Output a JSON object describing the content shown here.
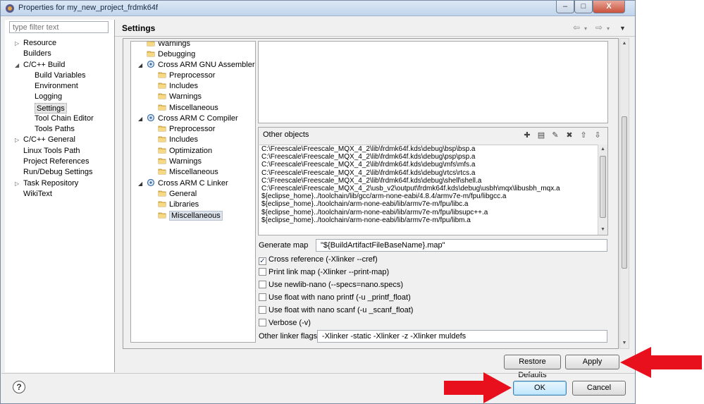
{
  "window": {
    "title": "Properties for my_new_project_frdmk64f",
    "minimize": "–",
    "maximize": "□",
    "close": "X"
  },
  "filter": {
    "placeholder": "type filter text"
  },
  "nav": [
    {
      "label": "Resource",
      "expander": "▷"
    },
    {
      "label": "Builders",
      "expander": ""
    },
    {
      "label": "C/C++ Build",
      "expander": "◢"
    },
    {
      "label": "Build Variables",
      "expander": ""
    },
    {
      "label": "Environment",
      "expander": ""
    },
    {
      "label": "Logging",
      "expander": ""
    },
    {
      "label": "Settings",
      "expander": "",
      "selected": true
    },
    {
      "label": "Tool Chain Editor",
      "expander": ""
    },
    {
      "label": "Tools Paths",
      "expander": ""
    },
    {
      "label": "C/C++ General",
      "expander": "▷"
    },
    {
      "label": "Linux Tools Path",
      "expander": ""
    },
    {
      "label": "Project References",
      "expander": ""
    },
    {
      "label": "Run/Debug Settings",
      "expander": ""
    },
    {
      "label": "Task Repository",
      "expander": "▷"
    },
    {
      "label": "WikiText",
      "expander": ""
    }
  ],
  "header": {
    "title": "Settings",
    "back": "⇦",
    "forward": "⇨",
    "dropdown": "▾",
    "menu": "▼"
  },
  "tree": [
    {
      "label": "Warnings",
      "icon": "folder-icon",
      "expander": ""
    },
    {
      "label": "Debugging",
      "icon": "folder-icon",
      "expander": ""
    },
    {
      "label": "Cross ARM GNU Assembler",
      "icon": "gear-icon",
      "expander": "◢"
    },
    {
      "label": "Preprocessor",
      "icon": "folder-icon",
      "expander": ""
    },
    {
      "label": "Includes",
      "icon": "folder-icon",
      "expander": ""
    },
    {
      "label": "Warnings",
      "icon": "folder-icon",
      "expander": ""
    },
    {
      "label": "Miscellaneous",
      "icon": "folder-icon",
      "expander": ""
    },
    {
      "label": "Cross ARM C Compiler",
      "icon": "gear-icon",
      "expander": "◢"
    },
    {
      "label": "Preprocessor",
      "icon": "folder-icon",
      "expander": ""
    },
    {
      "label": "Includes",
      "icon": "folder-icon",
      "expander": ""
    },
    {
      "label": "Optimization",
      "icon": "folder-icon",
      "expander": ""
    },
    {
      "label": "Warnings",
      "icon": "folder-icon",
      "expander": ""
    },
    {
      "label": "Miscellaneous",
      "icon": "folder-icon",
      "expander": ""
    },
    {
      "label": "Cross ARM C Linker",
      "icon": "gear-icon",
      "expander": "◢"
    },
    {
      "label": "General",
      "icon": "folder-icon",
      "expander": ""
    },
    {
      "label": "Libraries",
      "icon": "folder-icon",
      "expander": ""
    },
    {
      "label": "Miscellaneous",
      "icon": "folder-icon",
      "expander": "",
      "selected": true
    }
  ],
  "objects": {
    "label": "Other objects",
    "tools": [
      "add-icon",
      "add-workspace-icon",
      "edit-icon",
      "delete-icon",
      "move-up-icon",
      "move-down-icon"
    ],
    "tool_glyphs": [
      "✚",
      "▤",
      "✎",
      "✖",
      "⇧",
      "⇩"
    ],
    "items": [
      "C:\\Freescale\\Freescale_MQX_4_2\\lib\\frdmk64f.kds\\debug\\bsp\\bsp.a",
      "C:\\Freescale\\Freescale_MQX_4_2\\lib\\frdmk64f.kds\\debug\\psp\\psp.a",
      "C:\\Freescale\\Freescale_MQX_4_2\\lib\\frdmk64f.kds\\debug\\mfs\\mfs.a",
      "C:\\Freescale\\Freescale_MQX_4_2\\lib\\frdmk64f.kds\\debug\\rtcs\\rtcs.a",
      "C:\\Freescale\\Freescale_MQX_4_2\\lib\\frdmk64f.kds\\debug\\shell\\shell.a",
      "C:\\Freescale\\Freescale_MQX_4_2\\usb_v2\\output\\frdmk64f.kds\\debug\\usbh\\mqx\\libusbh_mqx.a",
      "${eclipse_home}../toolchain/lib/gcc/arm-none-eabi/4.8.4/armv7e-m/fpu/libgcc.a",
      "${eclipse_home}../toolchain/arm-none-eabi/lib/armv7e-m/fpu/libc.a",
      "${eclipse_home}../toolchain/arm-none-eabi/lib/armv7e-m/fpu/libsupc++.a",
      "${eclipse_home}../toolchain/arm-none-eabi/lib/armv7e-m/fpu/libm.a"
    ]
  },
  "generate_map": {
    "label": "Generate map",
    "value": "\"${BuildArtifactFileBaseName}.map\""
  },
  "checks": [
    {
      "label": "Cross reference (-Xlinker --cref)",
      "checked": true
    },
    {
      "label": "Print link map (-Xlinker --print-map)",
      "checked": false
    },
    {
      "label": "Use newlib-nano (--specs=nano.specs)",
      "checked": false
    },
    {
      "label": "Use float with nano printf (-u _printf_float)",
      "checked": false
    },
    {
      "label": "Use float with nano scanf (-u _scanf_float)",
      "checked": false
    },
    {
      "label": "Verbose (-v)",
      "checked": false
    }
  ],
  "other_flags": {
    "label": "Other linker flags",
    "value": "-Xlinker -static  -Xlinker -z -Xlinker muldefs"
  },
  "buttons": {
    "restore": "Restore Defaults",
    "apply": "Apply",
    "ok": "OK",
    "cancel": "Cancel",
    "help": "?"
  },
  "colors": {
    "arrow": "#e8101c",
    "selection": "#dde3ea",
    "accent": "#3c7fb1"
  }
}
